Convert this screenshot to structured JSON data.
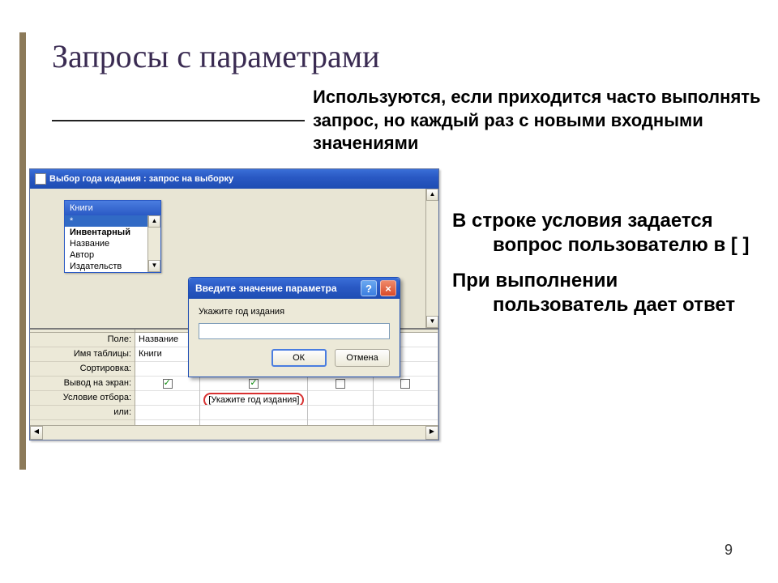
{
  "title": "Запросы с параметрами",
  "subtitle": "Используются, если приходится часто выполнять запрос, но каждый раз с новыми входными значениями",
  "body": {
    "p1": "В строке условия задается вопрос пользователю в [ ]",
    "p2": "При выполнении пользователь дает ответ"
  },
  "page_number": "9",
  "access_window": {
    "title": "Выбор года издания : запрос на выборку",
    "field_list": {
      "title": "Книги",
      "items": [
        "*",
        "Инвентарный",
        "Название",
        "Автор",
        "Издательств"
      ]
    },
    "grid": {
      "labels": [
        "Поле:",
        "Имя таблицы:",
        "Сортировка:",
        "Вывод на экран:",
        "Условие отбора:",
        "или:"
      ],
      "cols": [
        {
          "field": "Название",
          "table": "Книги",
          "sort": "",
          "show": true,
          "criteria": ""
        },
        {
          "field": "",
          "table": "",
          "sort": "",
          "show": true,
          "criteria": "[Укажите год издания]"
        },
        {
          "field": "",
          "table": "",
          "sort": "",
          "show": false,
          "criteria": ""
        }
      ]
    }
  },
  "param_dialog": {
    "title": "Введите значение параметра",
    "prompt": "Укажите год издания",
    "value": "",
    "ok": "ОК",
    "cancel": "Отмена"
  }
}
